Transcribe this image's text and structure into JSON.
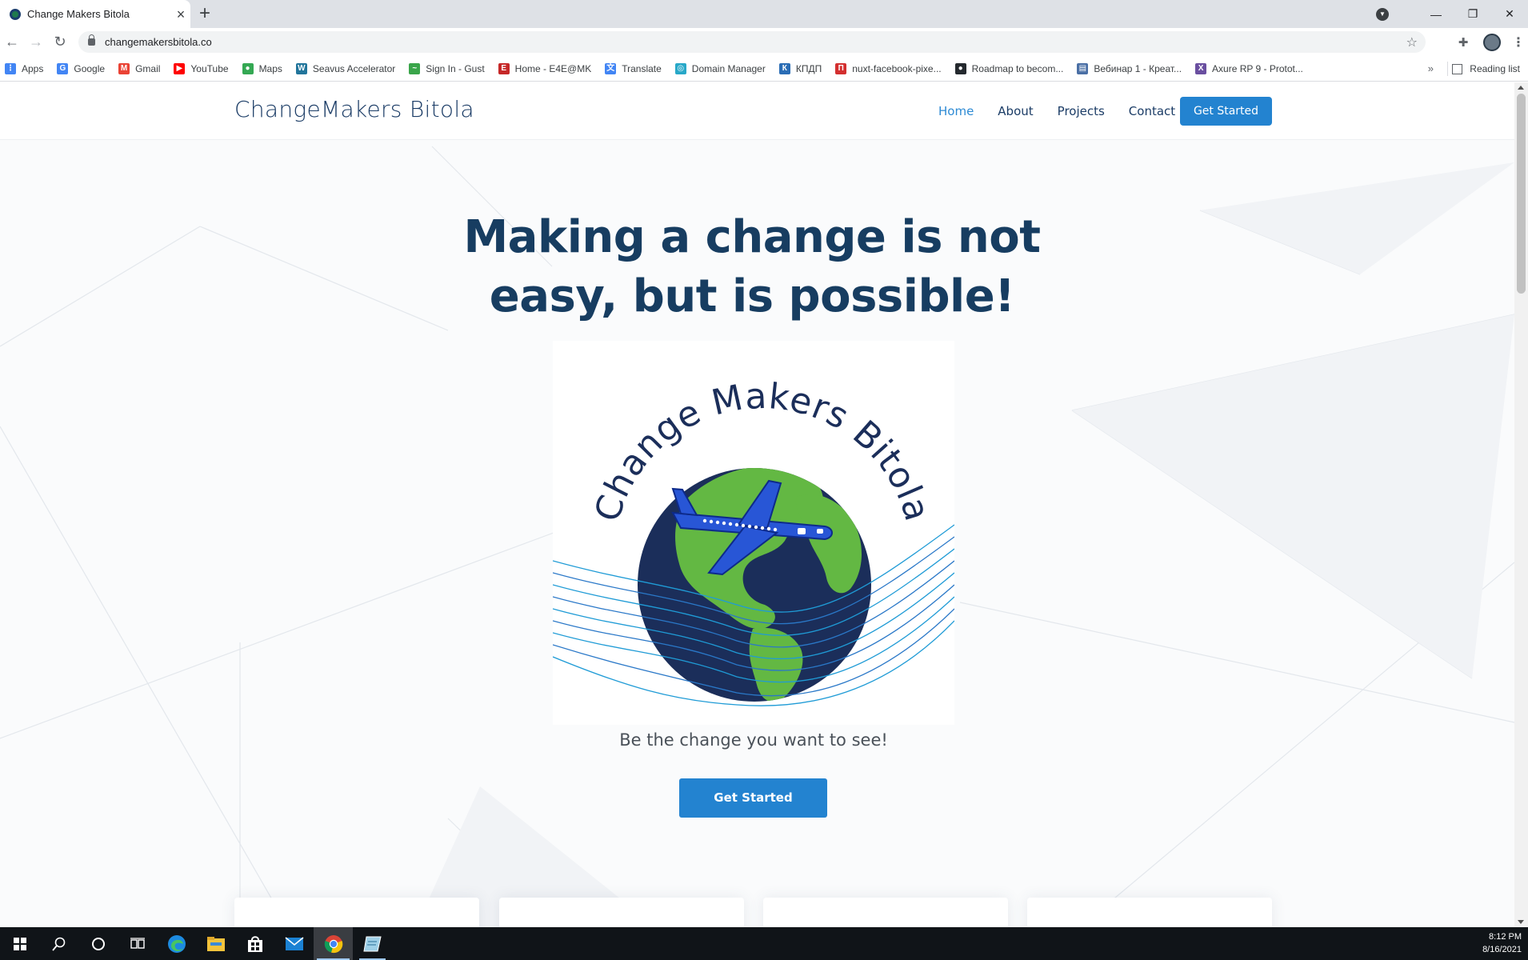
{
  "browser": {
    "tab_title": "Change Makers Bitola",
    "new_tab": "+",
    "url": "changemakersbitola.co",
    "bookmarks": [
      {
        "label": "Apps",
        "icon": "apps-grid-icon",
        "color": "#4285f4"
      },
      {
        "label": "Google",
        "icon": "google-icon",
        "color": "#4285f4"
      },
      {
        "label": "Gmail",
        "icon": "gmail-icon",
        "color": "#ea4335"
      },
      {
        "label": "YouTube",
        "icon": "youtube-icon",
        "color": "#ff0000"
      },
      {
        "label": "Maps",
        "icon": "maps-pin-icon",
        "color": "#34a853"
      },
      {
        "label": "Seavus Accelerator",
        "icon": "wordpress-icon",
        "color": "#21759b"
      },
      {
        "label": "Sign In - Gust",
        "icon": "gust-icon",
        "color": "#3aa54a"
      },
      {
        "label": "Home - E4E@MK",
        "icon": "e4e-icon",
        "color": "#c62828"
      },
      {
        "label": "Translate",
        "icon": "translate-icon",
        "color": "#4285f4"
      },
      {
        "label": "Domain Manager",
        "icon": "domain-icon",
        "color": "#28a8c8"
      },
      {
        "label": "КПДП",
        "icon": "kpdp-icon",
        "color": "#2a6db5"
      },
      {
        "label": "nuxt-facebook-pixe...",
        "icon": "red-square-icon",
        "color": "#d32f2f"
      },
      {
        "label": "Roadmap to becom...",
        "icon": "github-icon",
        "color": "#24292e"
      },
      {
        "label": "Вебинар 1 - Креат...",
        "icon": "webinar-icon",
        "color": "#4a6fa5"
      },
      {
        "label": "Axure RP 9 - Protot...",
        "icon": "axure-icon",
        "color": "#6a4fa0"
      }
    ],
    "bookmarks_more": "»",
    "reading_list": "Reading list"
  },
  "site": {
    "brand": "ChangeMakers Bitola",
    "nav": [
      {
        "label": "Home",
        "active": true
      },
      {
        "label": "About",
        "active": false
      },
      {
        "label": "Projects",
        "active": false
      },
      {
        "label": "Contact",
        "active": false
      }
    ],
    "nav_cta": "Get Started",
    "hero_title_line1": "Making a change is not",
    "hero_title_line2": "easy, but is possible!",
    "logo_text": "Change Makers Bitola",
    "tagline": "Be the change you want to see!",
    "hero_cta": "Get Started",
    "colors": {
      "brand_blue": "#2383d0",
      "navy": "#173d61",
      "globe_green": "#63b843",
      "globe_navy": "#1b2e5a"
    }
  },
  "taskbar": {
    "time": "8:12 PM",
    "date": "8/16/2021",
    "apps": [
      "start-icon",
      "search-icon",
      "cortana-icon",
      "task-view-icon",
      "edge-icon",
      "file-explorer-icon",
      "store-icon",
      "mail-icon",
      "chrome-icon",
      "notes-app-icon"
    ]
  }
}
